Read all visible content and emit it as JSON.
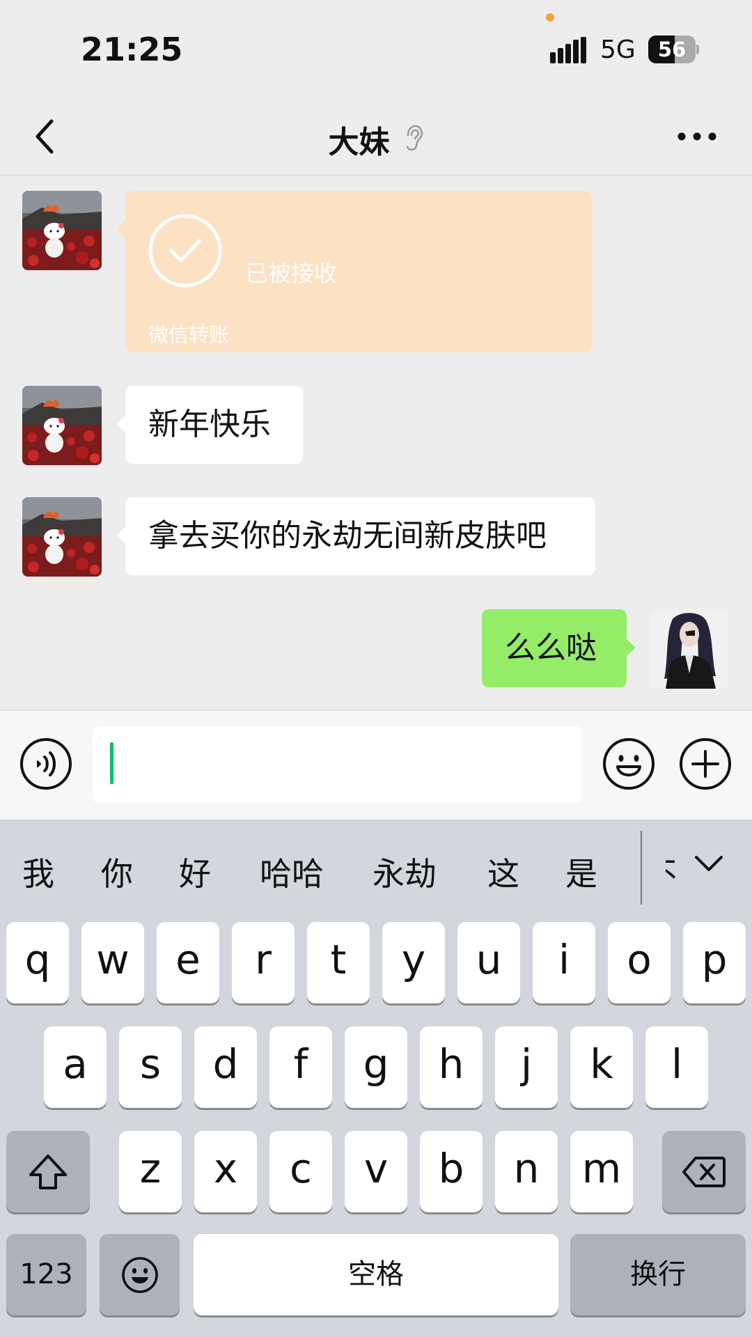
{
  "status_bar": {
    "time": "21:25",
    "network": "5G",
    "battery": "56",
    "battery_level": 0.56,
    "dot_color": "#f6a340"
  },
  "nav": {
    "title": "大妹",
    "back_icon": "chevron-left-icon",
    "title_icon": "ear-icon",
    "more_icon": "more-dots-icon"
  },
  "messages": {
    "transfer": {
      "sender": "contact",
      "status": "已被接收",
      "label": "微信转账",
      "icon": "check-circle-icon",
      "color": "#fde1c3"
    },
    "m1": {
      "sender": "contact",
      "text": "新年快乐"
    },
    "m2": {
      "sender": "contact",
      "text": "拿去买你的永劫无间新皮肤吧"
    },
    "m3": {
      "sender": "me",
      "text": "么么哒",
      "color": "#95ec69"
    }
  },
  "input_bar": {
    "voice_icon": "voice-icon",
    "value": "",
    "emoji_icon": "emoji-icon",
    "plus_icon": "plus-circle-icon",
    "caret_color": "#07c160"
  },
  "keyboard": {
    "candidates": [
      "我",
      "你",
      "好",
      "哈哈",
      "永劫",
      "这",
      "是",
      "不"
    ],
    "collapse_icon": "chevron-down-icon",
    "row1": [
      "q",
      "w",
      "e",
      "r",
      "t",
      "y",
      "u",
      "i",
      "o",
      "p"
    ],
    "row2": [
      "a",
      "s",
      "d",
      "f",
      "g",
      "h",
      "j",
      "k",
      "l"
    ],
    "row3": [
      "z",
      "x",
      "c",
      "v",
      "b",
      "n",
      "m"
    ],
    "shift_icon": "shift-icon",
    "backspace_icon": "backspace-icon",
    "numbers_label": "123",
    "emoji_key_icon": "emoji-icon",
    "space_label": "空格",
    "return_label": "换行"
  }
}
